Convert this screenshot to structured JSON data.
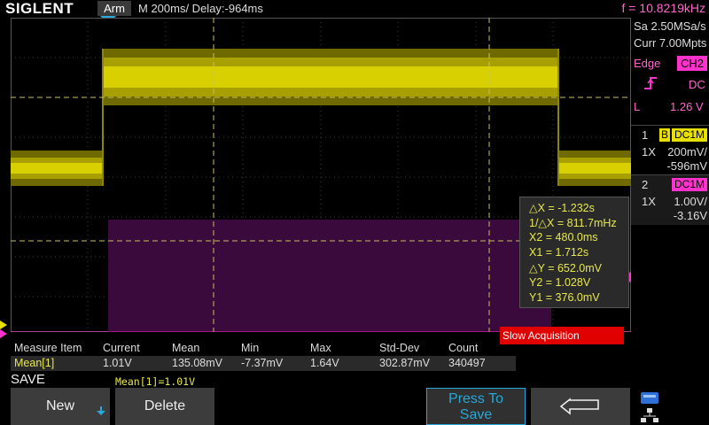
{
  "header": {
    "logo": "SIGLENT",
    "run_state": "Arm",
    "timebase": "M 200ms/  Delay:-964ms",
    "frequency": "f = 10.8219kHz"
  },
  "acquisition": {
    "sample_rate": "Sa 2.50MSa/s",
    "memory": "Curr 7.00Mpts"
  },
  "trigger": {
    "type": "Edge",
    "source": "CH2",
    "coupling": "DC",
    "level_label": "L",
    "level": "1.26 V"
  },
  "channels": [
    {
      "number": "1",
      "bw": "B",
      "coupling": "DC1M",
      "probe": "1X",
      "scale": "200mV/",
      "offset": "-596mV",
      "color": "#e8e000"
    },
    {
      "number": "2",
      "coupling": "DC1M",
      "probe": "1X",
      "scale": "1.00V/",
      "offset": "-3.16V",
      "color": "#ff33cc"
    }
  ],
  "cursors": {
    "dx": "△X = -1.232s",
    "inv_dx": "1/△X = 811.7mHz",
    "x2": "X2 = 480.0ms",
    "x1": "X1 = 1.712s",
    "dy": "△Y = 652.0mV",
    "y2": "Y2 = 1.028V",
    "y1": "Y1 = 376.0mV"
  },
  "measure": {
    "headers": [
      "Measure Item",
      "Current",
      "Mean",
      "Min",
      "Max",
      "Std-Dev",
      "Count"
    ],
    "row": [
      "Mean[1]",
      "1.01V",
      "135.08mV",
      "-7.37mV",
      "1.64V",
      "302.87mV",
      "340497"
    ]
  },
  "notice": "Slow Acquisition",
  "menu": {
    "title": "SAVE",
    "current_value": "Mean[1]=1.01V",
    "new_label": "New",
    "delete_label": "Delete",
    "press_to_save_line1": "Press To",
    "press_to_save_line2": "Save",
    "back_icon": "return-arrow-icon"
  },
  "colors": {
    "ch1": "#e8e000",
    "ch2": "#ff33cc",
    "cursor": "#c8c060",
    "accent": "#26a8d8"
  }
}
